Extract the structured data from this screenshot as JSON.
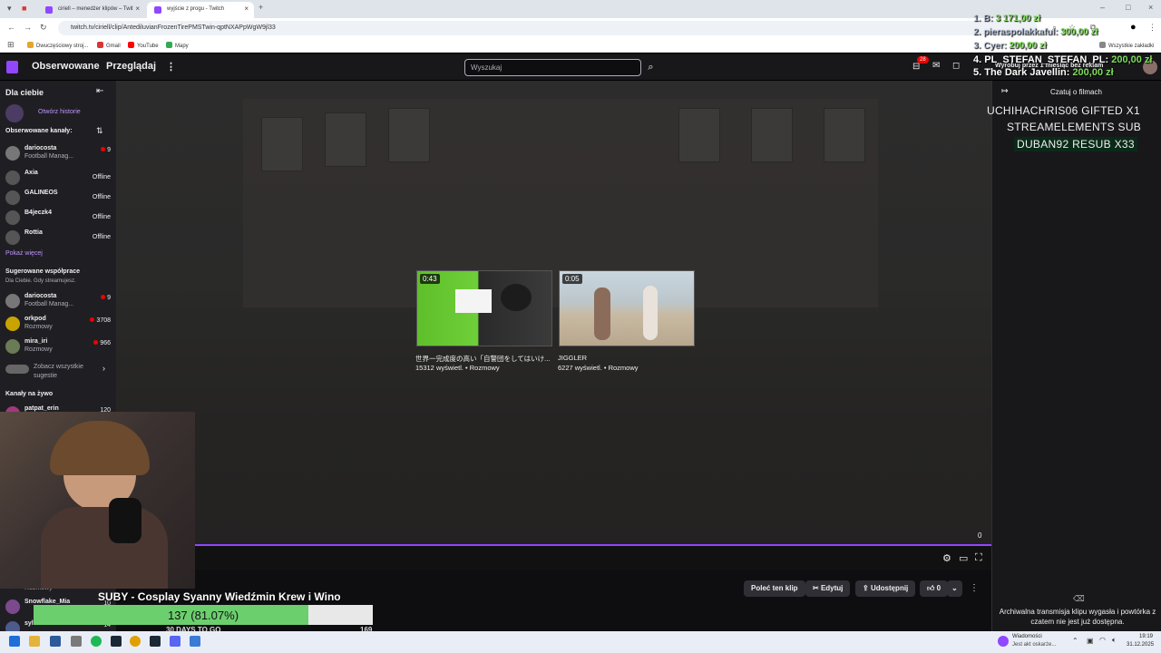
{
  "browser": {
    "tabs": [
      {
        "title": "ciriell – menedżer klipów – Twit"
      },
      {
        "title": "wyjście z progu - Twitch"
      }
    ],
    "url": "twitch.tv/ciriell/clip/AntediluvianFrozenTirePMSTwin-qptNXAPpWgW9jl33",
    "bookmarks": [
      "Dwuczęściowy stroj...",
      "Gmail",
      "YouTube",
      "Mapy"
    ],
    "all_bookmarks": "Wszystkie zakładki"
  },
  "twitch": {
    "nav": {
      "following": "Obserwowane",
      "browse": "Przeglądaj",
      "more": "⋮",
      "search_placeholder": "Wyszukaj",
      "notif_count": "28",
      "ad_free": "Wyrobuj przez 1 miesiąc bez reklam"
    },
    "sidebar": {
      "for_you": "Dla ciebie",
      "open_history": "Otwórz historie",
      "followed_header": "Obserwowane kanały:",
      "followed": [
        {
          "name": "dariocosta",
          "game": "Football Manag...",
          "status": "9",
          "live": true
        },
        {
          "name": "Axia",
          "game": "",
          "status": "Offline",
          "live": false
        },
        {
          "name": "GALINEOS",
          "game": "",
          "status": "Offline",
          "live": false
        },
        {
          "name": "B4jeczk4",
          "game": "",
          "status": "Offline",
          "live": false
        },
        {
          "name": "Rottia",
          "game": "",
          "status": "Offline",
          "live": false
        }
      ],
      "show_more": "Pokaż więcej",
      "suggested_header": "Sugerowane współprace",
      "suggested_sub": "Dla Ciebie. Gdy streamujesz.",
      "suggested": [
        {
          "name": "dariocosta",
          "game": "Football Manag...",
          "status": "9"
        },
        {
          "name": "orkpod",
          "game": "Rozmowy",
          "status": "3708"
        },
        {
          "name": "mira_iri",
          "game": "Rozmowy",
          "status": "966"
        }
      ],
      "see_all": "Zobacz wszystkie sugestie",
      "live_header": "Kanały na żywo",
      "live": [
        {
          "name": "patpat_erin",
          "status": "120"
        }
      ],
      "bottom_rows": [
        {
          "name": "Rozmowy",
          "status": ""
        },
        {
          "name": "Snowflake_Mia",
          "status": "10"
        },
        {
          "name": "sylwkra",
          "status": "14"
        }
      ]
    },
    "video": {
      "suggestions": [
        {
          "duration": "0:43",
          "title": "世界一完成度の高い「自警団をしてはいけ...",
          "meta": "15312 wyświetl. • Rozmowy"
        },
        {
          "duration": "0:05",
          "title": "JIGGLER",
          "meta": "6227 wyświetl. • Rozmowy"
        }
      ],
      "time": "0"
    },
    "actions": {
      "share_clip": "Poleć ten klip",
      "edit": "Edytuj",
      "share": "Udostępnij",
      "likes": "0"
    },
    "chat": {
      "header": "Czatuj o filmach",
      "archived_notice": "Archiwalna transmisja klipu wygasła i powtórka z czatem nie jest już dostępna."
    }
  },
  "overlay": {
    "leaderboard": [
      {
        "rank": "1.",
        "name": "B:",
        "amount": "3 171,00 zł"
      },
      {
        "rank": "2.",
        "name": "pieraspolakkaful:",
        "amount": "300,00 zł"
      },
      {
        "rank": "3.",
        "name": "Cyer:",
        "amount": "200,00 zł"
      },
      {
        "rank": "4.",
        "name": "PL_STEFAN_STEFAN_PL:",
        "amount": "200,00 zł"
      },
      {
        "rank": "5.",
        "name": "The Dark Javellin:",
        "amount": "200,00 zł"
      }
    ],
    "events": [
      "UCHIHACHRIS06  GIFTED X1",
      "STREAMELEMENTS  SUB",
      "DUBAN92  RESUB X33"
    ],
    "subgoal": {
      "title": "SUBY - Cosplay Syanny Wiedźmin Krew i Wino",
      "progress_text": "137 (81.07%)",
      "progress": 0.8107,
      "days": "30 DAYS TO GO",
      "target": "169"
    }
  },
  "taskbar": {
    "news": "Wiadomości",
    "news_sub": "Jest akt oskarże...",
    "time": "19:19",
    "date": "31.12.2025"
  },
  "colors": {
    "accent": "#9147ff",
    "goal": "#6ccf6e",
    "live": "#eb0400"
  }
}
